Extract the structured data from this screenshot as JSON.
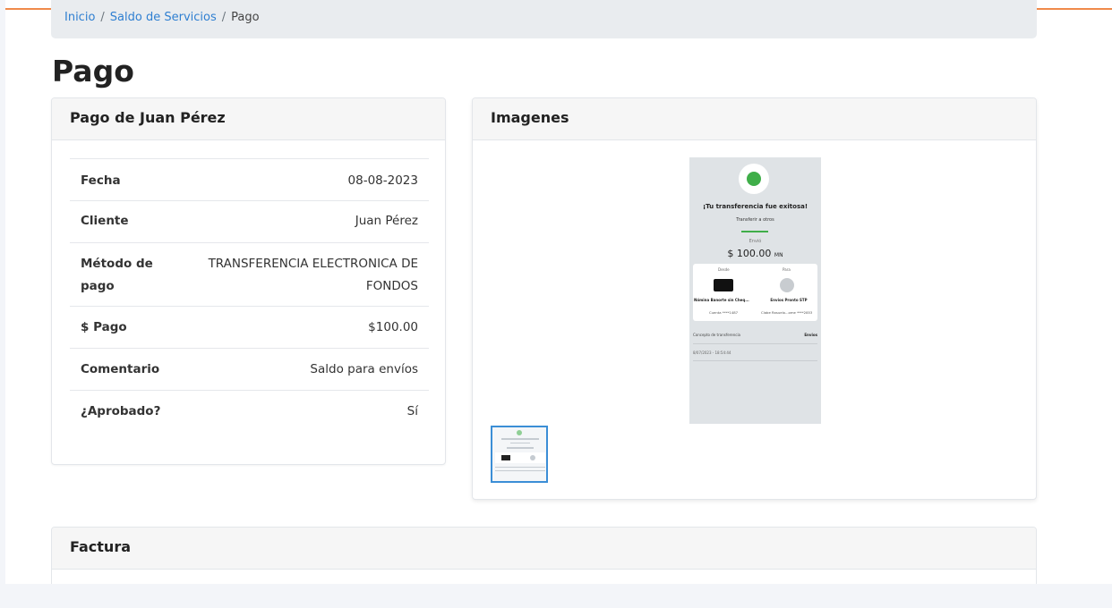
{
  "breadcrumb": {
    "home": "Inicio",
    "services": "Saldo de Servicios",
    "current": "Pago",
    "separator": "/"
  },
  "page_title": "Pago",
  "payment_card": {
    "title": "Pago de Juan Pérez",
    "rows": [
      {
        "label": "Fecha",
        "value": "08-08-2023"
      },
      {
        "label": "Cliente",
        "value": "Juan Pérez"
      },
      {
        "label": "Método de pago",
        "value": "TRANSFERENCIA ELECTRONICA DE FONDOS"
      },
      {
        "label": "$ Pago",
        "value": "$100.00"
      },
      {
        "label": "Comentario",
        "value": "Saldo para envíos"
      },
      {
        "label": "¿Aprobado?",
        "value": "Sí"
      }
    ]
  },
  "images_card": {
    "title": "Imagenes",
    "receipt": {
      "heading": "¡Tu transferencia fue exitosa!",
      "subheading": "Transferir a otros",
      "sent_label": "Envió",
      "amount": "$ 100.00",
      "currency": "MN",
      "from_label": "Desde",
      "to_label": "Para",
      "from_name": "Nómina Banorte sin Cheq...",
      "to_name": "Envios Pronto STP",
      "from_account": "Cuenta ****1487",
      "to_account": "Clabe Rasuelo...ome ****2853",
      "concept_label": "Concepto de transferencia",
      "concept_value": "Envios",
      "date": "8/07/2023 - 18:54:44"
    }
  },
  "invoice_card": {
    "title": "Factura"
  },
  "colors": {
    "accent": "#f08a4b",
    "link": "#2f7fd1",
    "thumb_border": "#3b8ed6",
    "success": "#3fae49"
  }
}
